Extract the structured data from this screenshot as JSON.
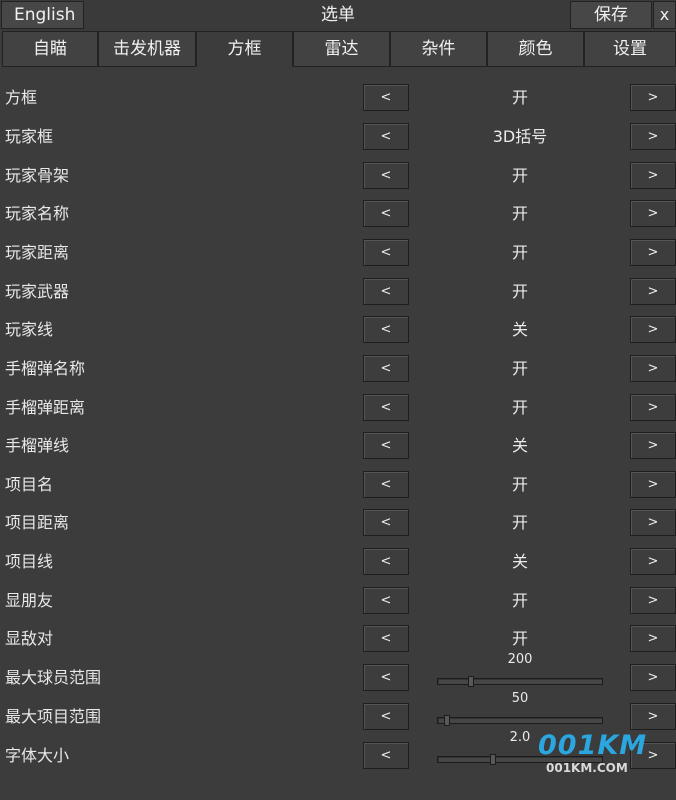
{
  "header": {
    "language_button": "English",
    "title": "选单",
    "save_button": "保存",
    "close_button": "x"
  },
  "tabs": [
    {
      "label": "自瞄",
      "active": false
    },
    {
      "label": "击发机器",
      "active": false
    },
    {
      "label": "方框",
      "active": true
    },
    {
      "label": "雷达",
      "active": false
    },
    {
      "label": "杂件",
      "active": false
    },
    {
      "label": "颜色",
      "active": false
    },
    {
      "label": "设置",
      "active": false
    }
  ],
  "arrows": {
    "left": "<",
    "right": ">"
  },
  "settings": [
    {
      "label": "方框",
      "value": "开"
    },
    {
      "label": "玩家框",
      "value": "3D括号"
    },
    {
      "label": "玩家骨架",
      "value": "开"
    },
    {
      "label": "玩家名称",
      "value": "开"
    },
    {
      "label": "玩家距离",
      "value": "开"
    },
    {
      "label": "玩家武器",
      "value": "开"
    },
    {
      "label": "玩家线",
      "value": "关"
    },
    {
      "label": "手榴弹名称",
      "value": "开"
    },
    {
      "label": "手榴弹距离",
      "value": "开"
    },
    {
      "label": "手榴弹线",
      "value": "关"
    },
    {
      "label": "项目名",
      "value": "开"
    },
    {
      "label": "项目距离",
      "value": "开"
    },
    {
      "label": "项目线",
      "value": "关"
    },
    {
      "label": "显朋友",
      "value": "开"
    },
    {
      "label": "显敌对",
      "value": "开"
    }
  ],
  "sliders": [
    {
      "label": "最大球员范围",
      "value": "200",
      "fraction": 0.19
    },
    {
      "label": "最大项目范围",
      "value": "50",
      "fraction": 0.04
    },
    {
      "label": "字体大小",
      "value": "2.0",
      "fraction": 0.33
    }
  ],
  "watermark": {
    "logo": "001KM",
    "site": "001KM.COM"
  },
  "colors": {
    "background": "#3c3c3c",
    "button": "#474747",
    "watermark": "#2aa6e0"
  }
}
